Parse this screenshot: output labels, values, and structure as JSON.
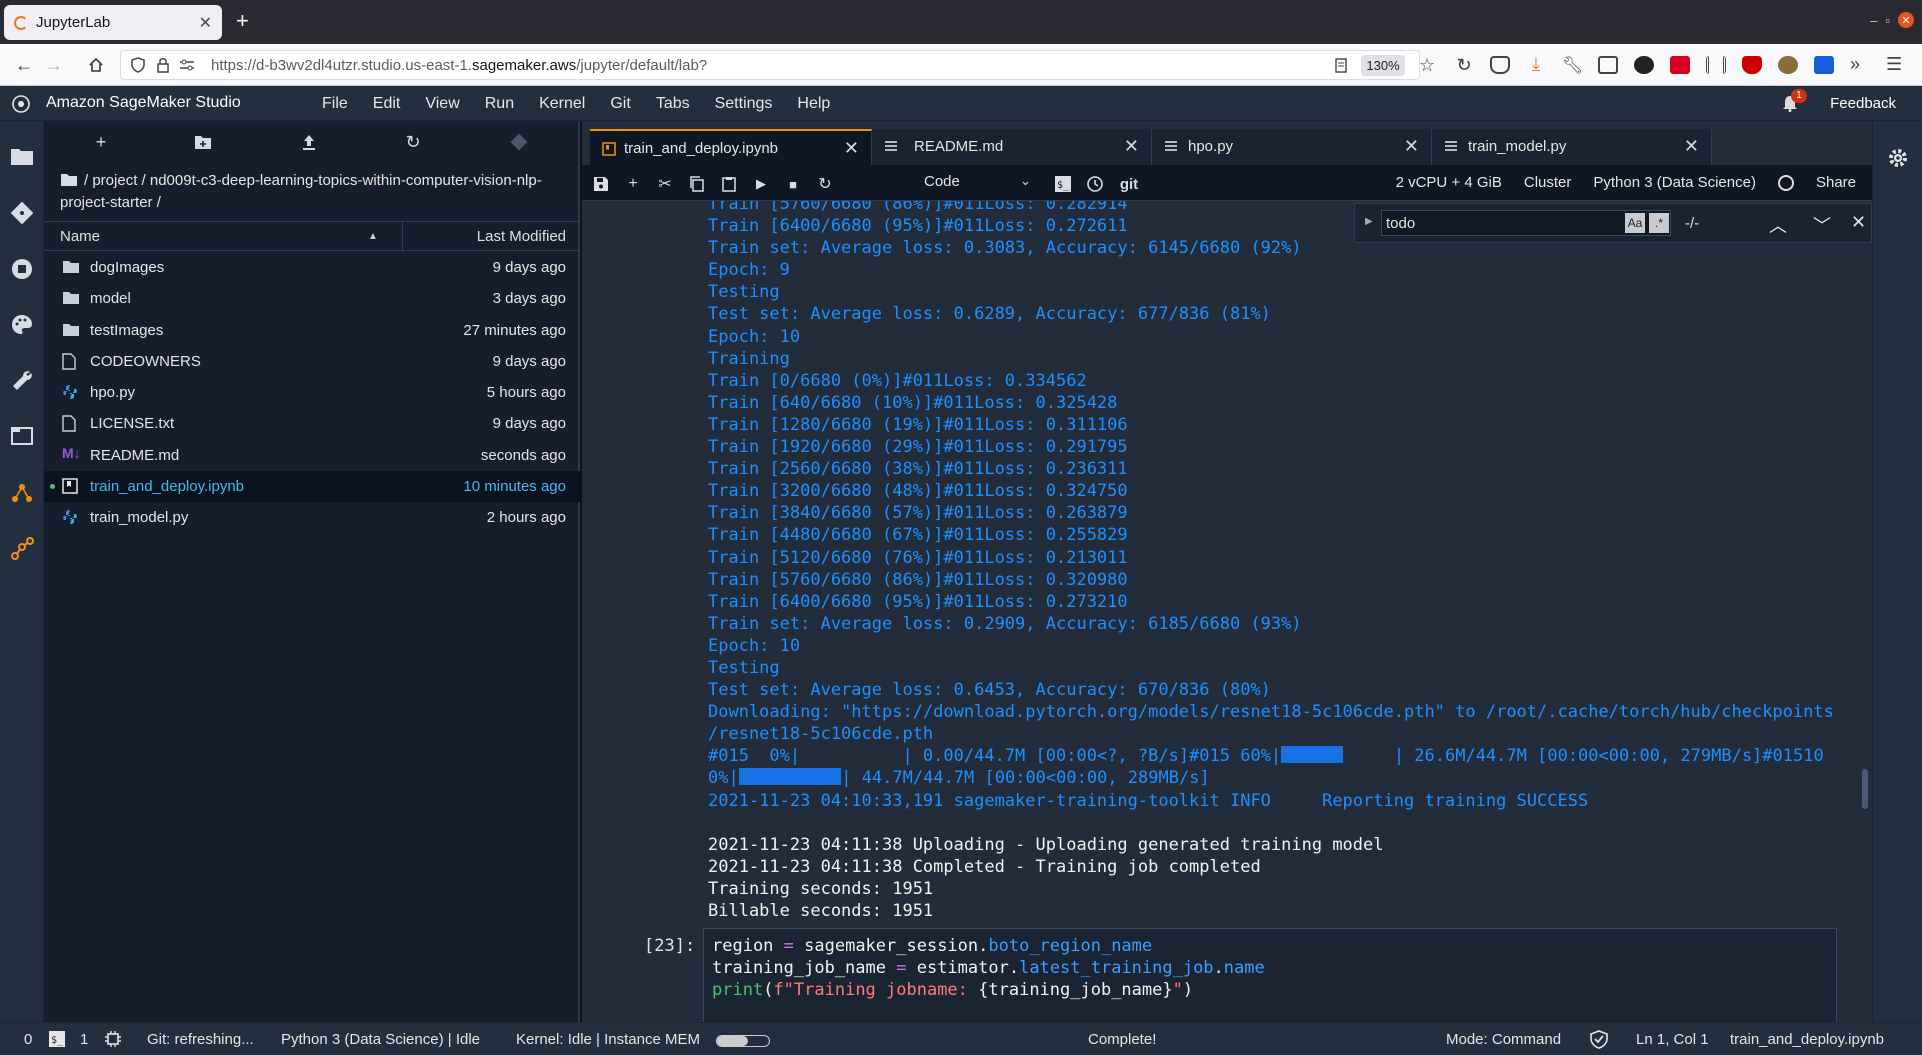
{
  "browser": {
    "tab_title": "JupyterLab",
    "url_prefix": "https://d-b3wv2dl4utzr.studio.us-east-1.",
    "url_domain": "sagemaker.aws",
    "url_suffix": "/jupyter/default/lab?",
    "zoom": "130%"
  },
  "app": {
    "title": "Amazon SageMaker Studio",
    "menu": [
      "File",
      "Edit",
      "View",
      "Run",
      "Kernel",
      "Git",
      "Tabs",
      "Settings",
      "Help"
    ],
    "notification_count": "1",
    "feedback": "Feedback"
  },
  "filebrowser": {
    "breadcrumb": "/ project / nd009t-c3-deep-learning-topics-within-computer-vision-nlp-project-starter /",
    "col_name": "Name",
    "col_modified": "Last Modified",
    "files": [
      {
        "name": "dogImages",
        "modified": "9 days ago",
        "icon": "folder-icon"
      },
      {
        "name": "model",
        "modified": "3 days ago",
        "icon": "folder-icon"
      },
      {
        "name": "testImages",
        "modified": "27 minutes ago",
        "icon": "folder-icon"
      },
      {
        "name": "CODEOWNERS",
        "modified": "9 days ago",
        "icon": "file-icon"
      },
      {
        "name": "hpo.py",
        "modified": "5 hours ago",
        "icon": "python-icon"
      },
      {
        "name": "LICENSE.txt",
        "modified": "9 days ago",
        "icon": "file-icon"
      },
      {
        "name": "README.md",
        "modified": "seconds ago",
        "icon": "markdown-icon"
      },
      {
        "name": "train_and_deploy.ipynb",
        "modified": "10 minutes ago",
        "icon": "notebook-icon"
      },
      {
        "name": "train_model.py",
        "modified": "2 hours ago",
        "icon": "python-icon"
      }
    ]
  },
  "tabs": [
    {
      "label": "train_and_deploy.ipynb"
    },
    {
      "label": "README.md"
    },
    {
      "label": "hpo.py"
    },
    {
      "label": "train_model.py"
    }
  ],
  "notebook_toolbar": {
    "cell_type": "Code",
    "resources": "2 vCPU + 4 GiB",
    "cluster": "Cluster",
    "kernel": "Python 3 (Data Science)",
    "share": "Share"
  },
  "find": {
    "query": "todo",
    "case_label": "Aa",
    "regex_label": ".*",
    "count": "-/-"
  },
  "output_lines": [
    "Train [5760/6680 (86%)]#011Loss: 0.282914",
    "Train [6400/6680 (95%)]#011Loss: 0.272611",
    "Train set: Average loss: 0.3083, Accuracy: 6145/6680 (92%)",
    "Epoch: 9",
    "Testing",
    "Test set: Average loss: 0.6289, Accuracy: 677/836 (81%)",
    "Epoch: 10",
    "Training",
    "Train [0/6680 (0%)]#011Loss: 0.334562",
    "Train [640/6680 (10%)]#011Loss: 0.325428",
    "Train [1280/6680 (19%)]#011Loss: 0.311106",
    "Train [1920/6680 (29%)]#011Loss: 0.291795",
    "Train [2560/6680 (38%)]#011Loss: 0.236311",
    "Train [3200/6680 (48%)]#011Loss: 0.324750",
    "Train [3840/6680 (57%)]#011Loss: 0.263879",
    "Train [4480/6680 (67%)]#011Loss: 0.255829",
    "Train [5120/6680 (76%)]#011Loss: 0.213011",
    "Train [5760/6680 (86%)]#011Loss: 0.320980",
    "Train [6400/6680 (95%)]#011Loss: 0.273210",
    "Train set: Average loss: 0.2909, Accuracy: 6185/6680 (93%)",
    "Epoch: 10",
    "Testing",
    "Test set: Average loss: 0.6453, Accuracy: 670/836 (80%)",
    "Downloading: \"https://download.pytorch.org/models/resnet18-5c106cde.pth\" to /root/.cache/torch/hub/checkpoints",
    "/resnet18-5c106cde.pth"
  ],
  "progress": {
    "line1_a": "#015  0%|          | 0.00/44.7M [00:00<?, ?B/s]#015 60%|",
    "line1_b": "     | 26.6M/44.7M [00:00<00:00, 279MB/s]#01510",
    "line2_a": "0%|",
    "line2_b": "| 44.7M/44.7M [00:00<00:00, 289MB/s]",
    "first_fill": 0.6,
    "second_fill": 1.0
  },
  "success_line": "2021-11-23 04:10:33,191 sagemaker-training-toolkit INFO     Reporting training SUCCESS",
  "white_lines": [
    "2021-11-23 04:11:38 Uploading - Uploading generated training model",
    "2021-11-23 04:11:38 Completed - Training job completed",
    "Training seconds: 1951",
    "Billable seconds: 1951"
  ],
  "cell": {
    "prompt": "[23]:",
    "l1_a": "region ",
    "l1_op": "=",
    "l1_b": " sagemaker_session.",
    "l1_attr": "boto_region_name",
    "l2_a": "training_job_name ",
    "l2_op": "=",
    "l2_b": " estimator.",
    "l2_attr": "latest_training_job",
    "l2_c": ".",
    "l2_attr2": "name",
    "l3_fn": "print",
    "l3_a": "(",
    "l3_str": "f\"Training jobname: ",
    "l3_b": "{training_job_name}",
    "l3_str2": "\"",
    "l3_c": ")"
  },
  "status": {
    "mode_count": "0",
    "terminals": "1",
    "git": "Git: refreshing...",
    "kernel_state": "Python 3 (Data Science) | Idle",
    "kernel_mem": "Kernel: Idle | Instance MEM",
    "mem_fill": 0.6,
    "complete": "Complete!",
    "mode": "Mode: Command",
    "position": "Ln 1, Col 1",
    "file": "train_and_deploy.ipynb"
  },
  "colors": {
    "accent": "#f29111",
    "output_blue": "#1e90ff",
    "selected_file": "#44b9f0",
    "topbar": "#232f3e"
  }
}
